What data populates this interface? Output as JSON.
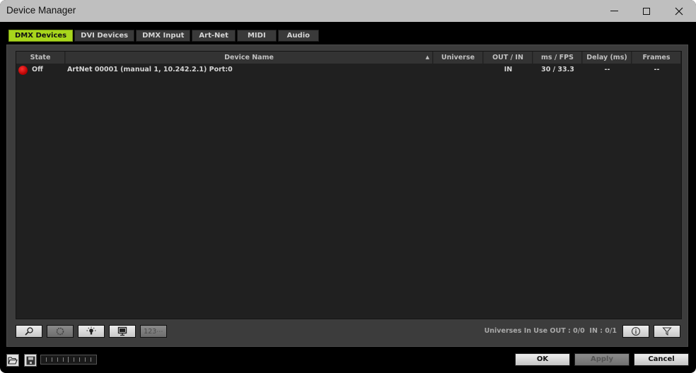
{
  "window": {
    "title": "Device Manager",
    "controls": {
      "minimize": "minimize-icon",
      "maximize": "maximize-icon",
      "close": "close-icon"
    }
  },
  "tabs": [
    {
      "label": "DMX Devices",
      "active": true
    },
    {
      "label": "DVI Devices",
      "active": false
    },
    {
      "label": "DMX Input",
      "active": false
    },
    {
      "label": "Art-Net",
      "active": false
    },
    {
      "label": "MIDI",
      "active": false
    },
    {
      "label": "Audio",
      "active": false
    }
  ],
  "table": {
    "columns": [
      {
        "label": "State"
      },
      {
        "label": "Device Name",
        "sorted": "ascending"
      },
      {
        "label": "Universe"
      },
      {
        "label": "OUT / IN"
      },
      {
        "label": "ms / FPS"
      },
      {
        "label": "Delay (ms)"
      },
      {
        "label": "Frames"
      }
    ],
    "rows": [
      {
        "state_indicator": "red",
        "state": "Off",
        "device_name": "ArtNet 00001 (manual 1, 10.242.2.1) Port:0",
        "universe": "",
        "out_in": "IN",
        "ms_fps": "30 / 33.3",
        "delay": "--",
        "frames": "--"
      }
    ]
  },
  "toolbar": {
    "buttons": [
      {
        "icon": "search-icon",
        "enabled": true
      },
      {
        "icon": "gear-icon",
        "enabled": false
      },
      {
        "icon": "light-bulb-icon",
        "enabled": true
      },
      {
        "icon": "monitor-icon",
        "enabled": true
      },
      {
        "icon": "numbering-icon",
        "label": "123⋯",
        "enabled": false
      }
    ],
    "universes_text": "Universes In Use OUT : 0/0  IN : 0/1",
    "info_icon": "info-icon",
    "filter_icon": "filter-icon"
  },
  "footer": {
    "open_icon": "folder-open-icon",
    "save_icon": "save-icon",
    "ok_label": "OK",
    "apply_label": "Apply",
    "apply_enabled": false,
    "cancel_label": "Cancel"
  }
}
